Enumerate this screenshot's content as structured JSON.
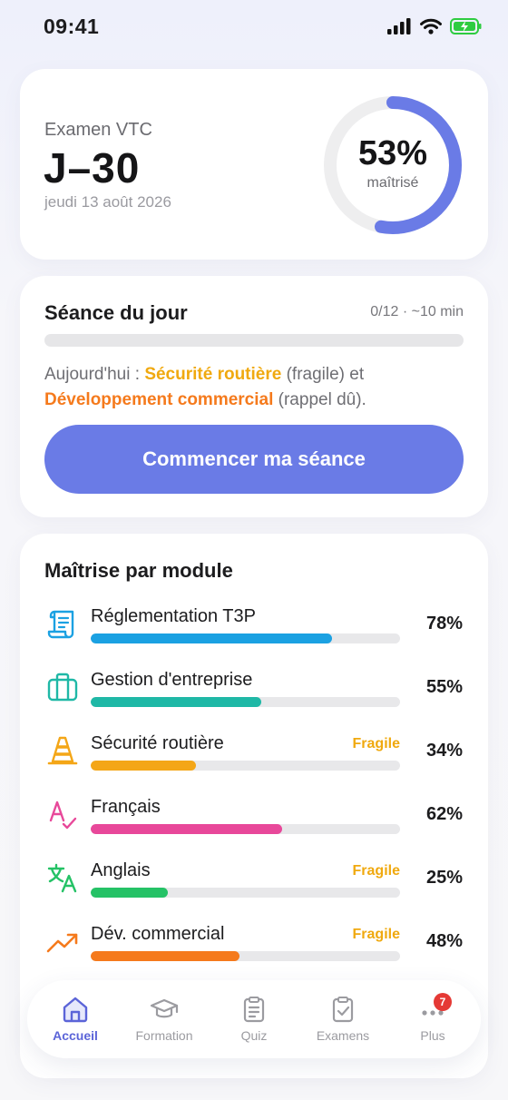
{
  "status_bar": {
    "time": "09:41"
  },
  "exam": {
    "label": "Examen VTC",
    "countdown": "J–30",
    "date": "jeudi 13 août 2026",
    "mastery_value": "53%",
    "mastery_fraction": 0.53,
    "mastery_label": "maîtrisé"
  },
  "session": {
    "title": "Séance du jour",
    "meta": "0/12 · ~10 min",
    "progress_fraction": 0,
    "text_prefix": "Aujourd'hui : ",
    "topic1": "Sécurité routière",
    "topic1_note": " (fragile) et",
    "topic2": "Développement commercial",
    "topic2_note": " (rappel dû).",
    "button_label": "Commencer ma séance"
  },
  "modules": {
    "title": "Maîtrise par module",
    "items": [
      {
        "name": "Réglementation T3P",
        "percent": "78%",
        "fraction": 0.78,
        "flag": "",
        "color": "#1ba1e2",
        "icon": "scroll-icon"
      },
      {
        "name": "Gestion d'entreprise",
        "percent": "55%",
        "fraction": 0.55,
        "flag": "",
        "color": "#1fb8a6",
        "icon": "briefcase-icon"
      },
      {
        "name": "Sécurité routière",
        "percent": "34%",
        "fraction": 0.34,
        "flag": "Fragile",
        "color": "#f4a617",
        "icon": "traffic-cone-icon"
      },
      {
        "name": "Français",
        "percent": "62%",
        "fraction": 0.62,
        "flag": "",
        "color": "#e8489a",
        "icon": "spellcheck-icon"
      },
      {
        "name": "Anglais",
        "percent": "25%",
        "fraction": 0.25,
        "flag": "Fragile",
        "color": "#25c266",
        "icon": "translate-icon"
      },
      {
        "name": "Dév. commercial",
        "percent": "48%",
        "fraction": 0.48,
        "flag": "Fragile",
        "color": "#f57a1c",
        "icon": "trending-up-icon"
      }
    ]
  },
  "nav": {
    "items": [
      {
        "label": "Accueil",
        "icon": "home-icon"
      },
      {
        "label": "Formation",
        "icon": "graduation-cap-icon"
      },
      {
        "label": "Quiz",
        "icon": "clipboard-icon"
      },
      {
        "label": "Examens",
        "icon": "clipboard-check-icon"
      },
      {
        "label": "Plus",
        "icon": "more-icon",
        "badge": "7"
      }
    ]
  },
  "colors": {
    "accent": "#6a7be6",
    "nav_active": "#5b64d8",
    "fragile": "#f0a90f",
    "badge": "#e53935"
  }
}
